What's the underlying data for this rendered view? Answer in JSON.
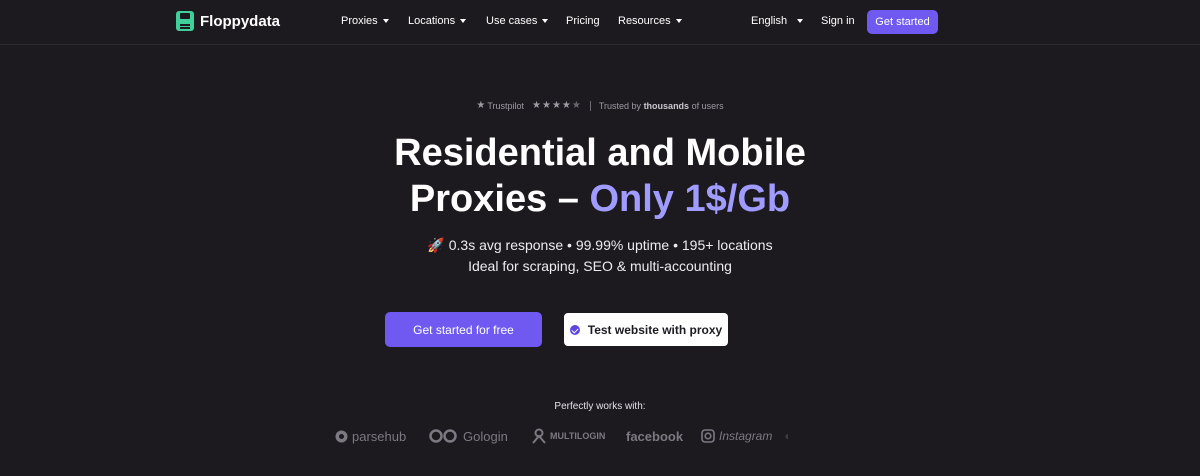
{
  "header": {
    "brand": "Floppydata",
    "nav": [
      {
        "label": "Proxies",
        "dropdown": true
      },
      {
        "label": "Locations",
        "dropdown": true
      },
      {
        "label": "Use cases",
        "dropdown": true
      },
      {
        "label": "Pricing",
        "dropdown": false
      },
      {
        "label": "Resources",
        "dropdown": true
      }
    ],
    "language": "English",
    "sign_in": "Sign in",
    "cta": "Get started"
  },
  "trust": {
    "provider": "Trustpilot",
    "rating_stars": 4.5,
    "prefix": "Trusted by",
    "highlight": "thousands",
    "suffix": "of users"
  },
  "hero": {
    "line1": "Residential and Mobile",
    "line2_plain": "Proxies –",
    "line2_accent": "Only 1$/Gb",
    "sub1": "🚀 0.3s avg response • 99.99% uptime • 195+ locations",
    "sub2": "Ideal for scraping, SEO & multi-accounting"
  },
  "buttons": {
    "primary": "Get started for free",
    "secondary": "Test website with proxy"
  },
  "partners": {
    "heading": "Perfectly works with:",
    "logos": [
      "parsehub",
      "Gologin",
      "MULTILOGIN",
      "facebook",
      "Instagram"
    ]
  },
  "colors": {
    "background": "#1c1a1e",
    "accent": "#6f59f0",
    "accent_text": "#a09cff",
    "logo_green": "#3fcf9a"
  }
}
